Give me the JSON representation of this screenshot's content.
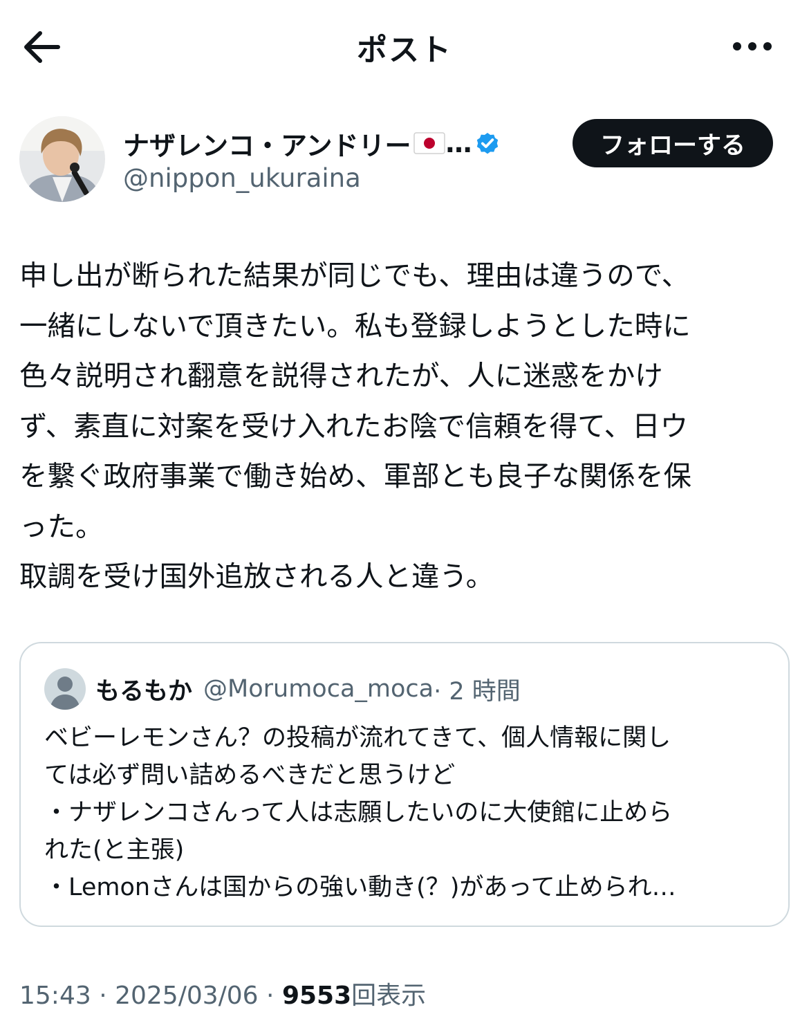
{
  "header": {
    "title": "ポスト",
    "back_icon": "arrow-left-icon",
    "more_icon": "more-dots-icon"
  },
  "author": {
    "display_name": "ナザレンコ・アンドリー",
    "flag": "🇯🇵",
    "ellipsis": "…",
    "handle": "@nippon_ukuraina",
    "verified_color": "#1d9bf0",
    "follow_label": "フォローする"
  },
  "post": {
    "text": "申し出が断られた結果が同じでも、理由は違うので、\n一緒にしないで頂きたい。私も登録しようとした時に\n色々説明され翻意を説得されたが、人に迷惑をかけ\nず、素直に対案を受け入れたお陰で信頼を得て、日ウ\nを繋ぐ政府事業で働き始め、軍部とも良子な関係を保\nった。\n取調を受け国外追放される人と違う。"
  },
  "quote": {
    "name": "もるもか",
    "handle": "@Morumoca_moca",
    "time": "· 2 時間",
    "text": "ベビーレモンさん？の投稿が流れてきて、個人情報に関し\nては必ず問い詰めるべきだと思うけど\n・ナザレンコさんって人は志願したいのに大使館に止めら\nれた(と主張)\n・Lemonさんは国からの強い動き(？)があって止められ…"
  },
  "meta": {
    "time": "15:43",
    "sep1": " · ",
    "date": "2025/03/06",
    "sep2": " · ",
    "views": "9553",
    "views_label": "回表示"
  },
  "colors": {
    "text": "#0f1419",
    "secondary": "#536471",
    "border": "#cfd9de",
    "accent": "#1d9bf0"
  }
}
